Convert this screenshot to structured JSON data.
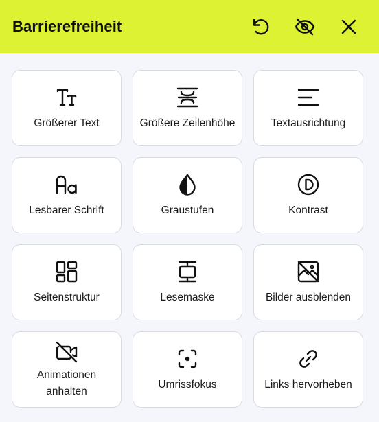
{
  "header": {
    "title": "Barrierefreiheit",
    "actions": [
      {
        "name": "reset-button",
        "icon": "reset-icon"
      },
      {
        "name": "hide-button",
        "icon": "eye-off-icon"
      },
      {
        "name": "close-button",
        "icon": "close-icon"
      }
    ]
  },
  "colors": {
    "accent": "#dcf233",
    "background": "#f4f6fc",
    "tile": "#ffffff"
  },
  "tiles": [
    {
      "label": "Größerer Text",
      "icon": "text-size-icon"
    },
    {
      "label": "Größere Zeilenhöhe",
      "icon": "line-height-icon"
    },
    {
      "label": "Textausrichtung",
      "icon": "text-align-icon"
    },
    {
      "label": "Lesbarer Schrift",
      "icon": "font-icon"
    },
    {
      "label": "Graustufen",
      "icon": "grayscale-icon"
    },
    {
      "label": "Kontrast",
      "icon": "contrast-icon"
    },
    {
      "label": "Seitenstruktur",
      "icon": "page-structure-icon"
    },
    {
      "label": "Lesemaske",
      "icon": "reading-mask-icon"
    },
    {
      "label": "Bilder ausblenden",
      "icon": "hide-images-icon"
    },
    {
      "label": "Animationen anhalten",
      "icon": "stop-animations-icon"
    },
    {
      "label": "Umrissfokus",
      "icon": "outline-focus-icon"
    },
    {
      "label": "Links hervorheben",
      "icon": "highlight-links-icon"
    }
  ]
}
